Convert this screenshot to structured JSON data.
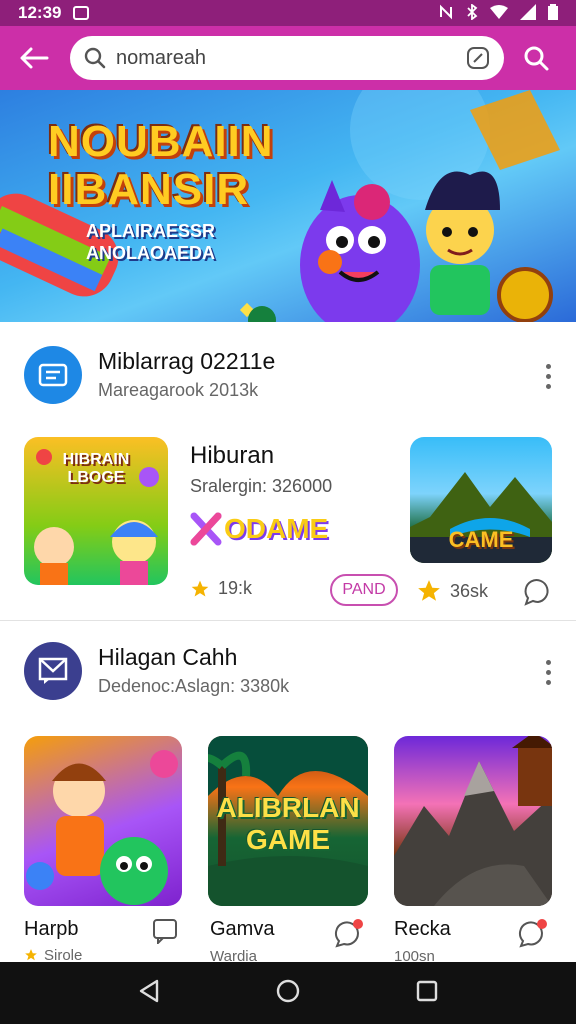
{
  "status": {
    "time": "12:39"
  },
  "search": {
    "value": "nomareah"
  },
  "banner": {
    "title_line1": "NOUBAIIN",
    "title_line2": "IIBANSIR",
    "sub_line1": "APLAIRAESSR",
    "sub_line2": "ANOLAOAEDA"
  },
  "section1": {
    "title": "Miblarrag 02211e",
    "subtitle": "Mareagarook 2013k",
    "featured": {
      "title": "Hiburan",
      "subtitle": "Sralergin: 326000",
      "logo_text": "ODAME",
      "rating": "19:k"
    },
    "thumb1_text_line1": "HIBRAIN",
    "thumb1_text_line2": "LBOGE",
    "thumb2_text": "CAME",
    "chip_label": "PAND",
    "rating2": "36sk"
  },
  "section2": {
    "title": "Hilagan Cahh",
    "subtitle": "Dedenoc:Aslagn: 3380k",
    "apps": [
      {
        "name": "Harpb",
        "sub": "Sirole",
        "thumb_text": ""
      },
      {
        "name": "Gamva",
        "sub": "Wardia",
        "thumb_text_line1": "ALIBRLAN",
        "thumb_text_line2": "GAME"
      },
      {
        "name": "Recka",
        "sub": "100sn"
      }
    ]
  },
  "colors": {
    "status_bar": "#8e1f7a",
    "app_bar": "#cc2fa8",
    "accent_blue": "#1e88e5",
    "section2_icon": "#3b3f8f"
  },
  "icons": [
    "back-arrow-icon",
    "search-icon",
    "lens-icon",
    "more-vert-icon",
    "star-icon",
    "chat-bubble-icon",
    "home-icon",
    "recents-icon",
    "back-triangle-icon"
  ]
}
